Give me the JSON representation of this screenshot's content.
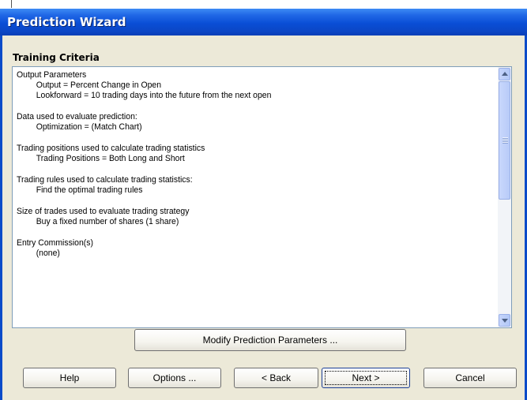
{
  "window": {
    "title": "Prediction Wizard"
  },
  "section_heading": "Training Criteria",
  "criteria": [
    {
      "heading": "Output Parameters",
      "lines": [
        "Output = Percent Change in Open",
        "Lookforward = 10 trading days into the future from the next open"
      ]
    },
    {
      "heading": "Data used to evaluate prediction:",
      "lines": [
        "Optimization = (Match Chart)"
      ]
    },
    {
      "heading": "Trading positions used to calculate trading statistics",
      "lines": [
        "Trading Positions = Both Long and Short"
      ]
    },
    {
      "heading": "Trading rules used to calculate trading statistics:",
      "lines": [
        "Find the optimal trading rules"
      ]
    },
    {
      "heading": "Size of trades used to evaluate trading strategy",
      "lines": [
        "Buy a fixed number of shares (1 share)"
      ]
    },
    {
      "heading": "Entry Commission(s)",
      "lines": [
        "(none)"
      ]
    }
  ],
  "scrollbar": {
    "up_icon": "arrow-up-icon",
    "down_icon": "arrow-down-icon"
  },
  "buttons": {
    "modify": "Modify Prediction Parameters ...",
    "help": "Help",
    "options": "Options ...",
    "back": "< Back",
    "next": "Next >",
    "cancel": "Cancel"
  },
  "colors": {
    "titlebar": "#0a4ed6",
    "dialog_bg": "#ece9d8",
    "textbox_border": "#7f9db9"
  }
}
